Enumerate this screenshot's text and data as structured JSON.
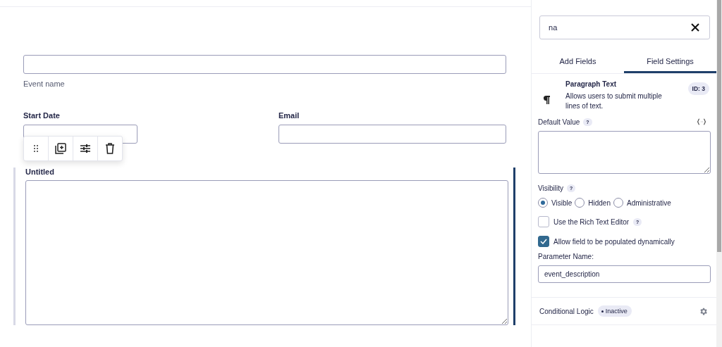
{
  "form": {
    "fields": [
      {
        "kind": "text",
        "sublabel": "Event name"
      },
      {
        "kind": "pair",
        "items": [
          {
            "label": "Start Date"
          },
          {
            "label": "Email"
          }
        ]
      },
      {
        "kind": "textarea",
        "label": "Untitled",
        "selected": true
      }
    ]
  },
  "settings": {
    "search": {
      "value": "na"
    },
    "tabs": [
      {
        "label": "Add Fields",
        "selected": false
      },
      {
        "label": "Field Settings",
        "selected": true
      }
    ],
    "field": {
      "title": "Paragraph Text",
      "description": "Allows users to submit multiple lines of text.",
      "id_badge": "ID: 3"
    },
    "default_value": {
      "label": "Default Value",
      "help": "?"
    },
    "visibility": {
      "label": "Visibility",
      "help": "?",
      "options": [
        {
          "label": "Visible",
          "selected": true
        },
        {
          "label": "Hidden",
          "selected": false
        },
        {
          "label": "Administrative",
          "selected": false
        }
      ]
    },
    "checkboxes": [
      {
        "label": "Use the Rich Text Editor",
        "checked": false,
        "help": "?"
      },
      {
        "label": "Allow field to be populated dynamically",
        "checked": true
      }
    ],
    "parameter": {
      "label": "Parameter Name:",
      "value": "event_description"
    },
    "conditional_logic": {
      "label": "Conditional Logic",
      "status": "Inactive"
    }
  }
}
